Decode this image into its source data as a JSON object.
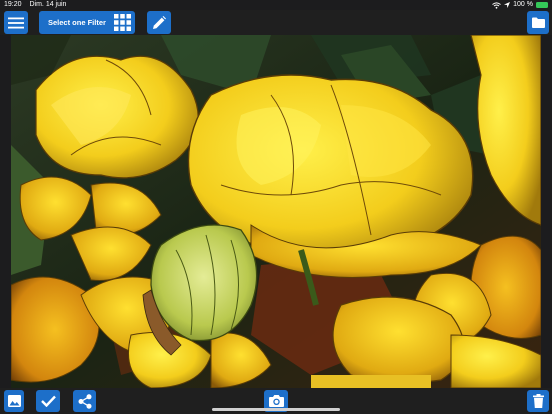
{
  "status_bar": {
    "time": "19:20",
    "date": "Dim. 14 juin",
    "battery_text": "100 %"
  },
  "toolbar": {
    "filter_label": "Select one Filter"
  },
  "icons": {
    "menu": "hamburger-menu-icon",
    "filter_grid": "grid-icon",
    "edit": "pencil-icon",
    "folder": "folder-icon",
    "gallery": "image-gallery-icon",
    "check": "checkmark-icon",
    "share": "share-icon",
    "camera": "camera-icon",
    "trash": "trash-icon"
  },
  "colors": {
    "accent": "#1d6fc9",
    "bar_background": "#1f1f1f",
    "battery": "#34c759"
  }
}
